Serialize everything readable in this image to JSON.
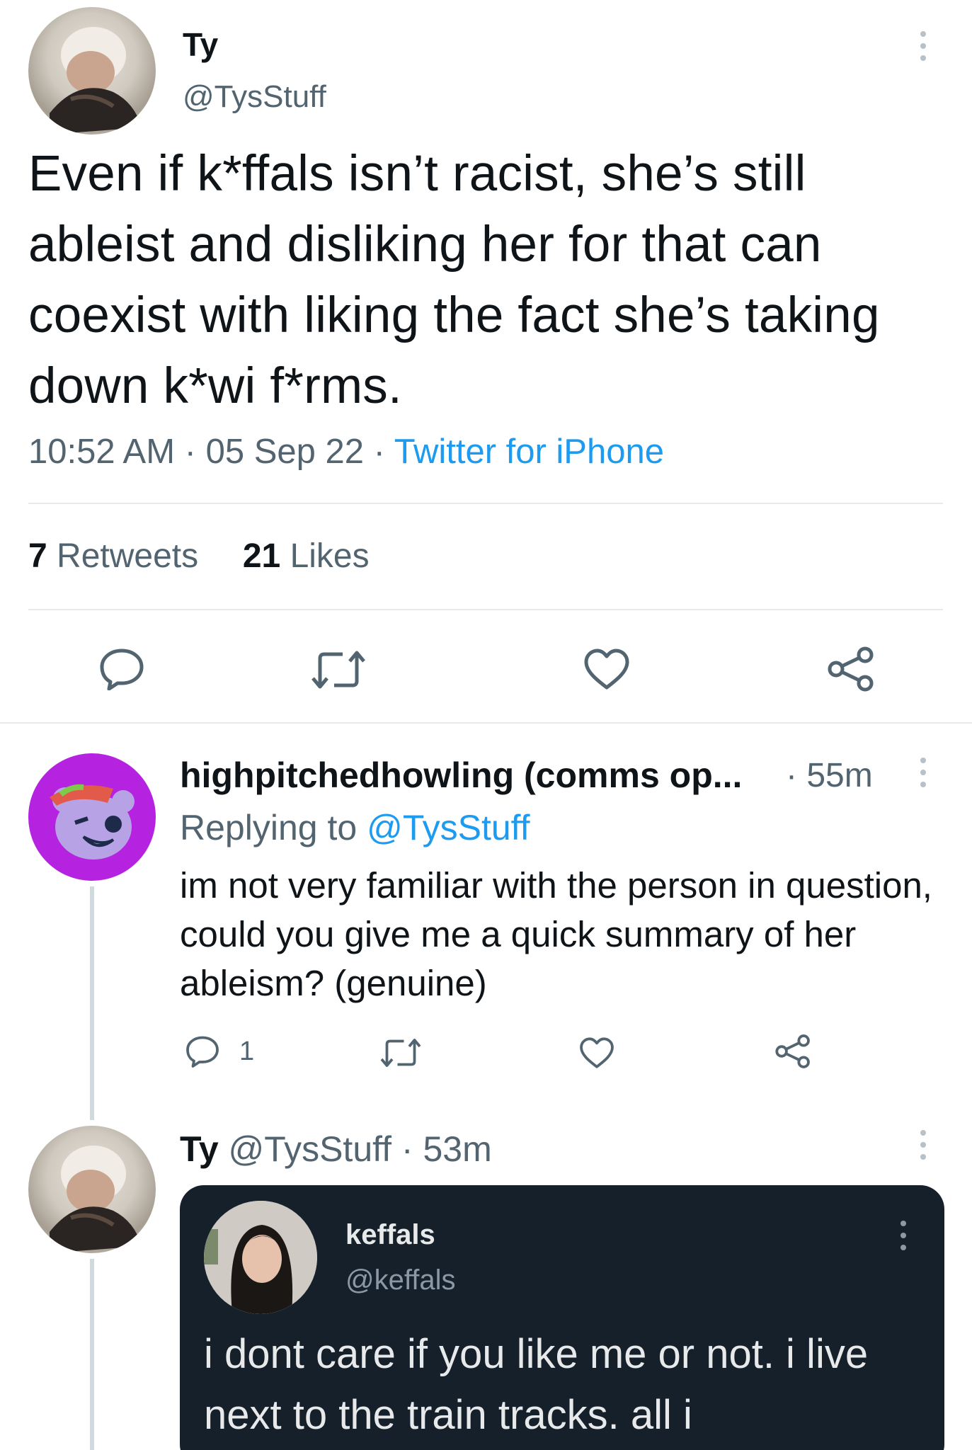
{
  "main_tweet": {
    "author_name": "Ty",
    "author_handle": "@TysStuff",
    "text": "Even if k*ffals isn’t racist, she’s still ableist and disliking her for that can coexist with liking the fact she’s taking down k*wi f*rms.",
    "time": "10:52 AM",
    "date": "05 Sep 22",
    "source": "Twitter for iPhone",
    "sep": "·",
    "retweets_count": "7",
    "retweets_label": "Retweets",
    "likes_count": "21",
    "likes_label": "Likes"
  },
  "reply_1": {
    "author_name": "highpitchedhowling (comms op...",
    "time": "· 55m",
    "replying_prefix": "Replying to",
    "replying_handle": "@TysStuff",
    "text": "im not very familiar with the person in question, could you give me a quick summary of her ableism? (genuine)",
    "reply_count": "1"
  },
  "reply_2": {
    "author_name": "Ty",
    "author_handle": "@TysStuff",
    "time": "· 53m",
    "quoted": {
      "author_name": "keffals",
      "author_handle": "@keffals",
      "text": "i dont care if you like me or not. i live next to the train tracks. all i"
    }
  },
  "colors": {
    "text_primary": "#0f1419",
    "text_secondary": "#536471",
    "link_blue": "#1d9bf0",
    "divider": "#e7e9eb",
    "dark_card": "#15202b",
    "avatar_purple": "#b522e0"
  },
  "icons": [
    "more-vertical-icon",
    "reply-icon",
    "retweet-icon",
    "like-icon",
    "share-icon"
  ]
}
